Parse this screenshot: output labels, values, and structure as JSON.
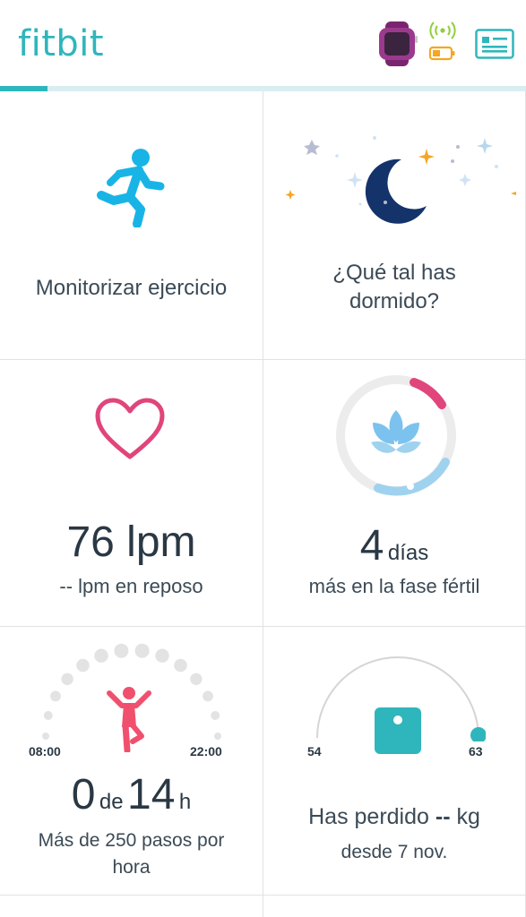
{
  "header": {
    "logo": "fitbit",
    "icons": {
      "device": "smartwatch-icon",
      "sync": "sync-signal-icon",
      "battery": "battery-low-icon",
      "profile": "profile-card-icon"
    },
    "progress_percent": 9,
    "colors": {
      "brand": "#2fb6bc",
      "watch": "#8b2a7a",
      "battery": "#f5a623",
      "signal": "#8ecf3c"
    }
  },
  "tiles": {
    "exercise": {
      "label": "Monitorizar ejercicio",
      "icon": "running-person-icon"
    },
    "sleep": {
      "label_line1": "¿Qué tal has",
      "label_line2": "dormido?",
      "icon": "moon-stars-icon"
    },
    "heart": {
      "value": "76 lpm",
      "sub": "-- lpm en reposo",
      "icon": "heart-icon"
    },
    "cycle": {
      "value": "4",
      "unit": "días",
      "sub": "más en la fase fértil",
      "icon": "lotus-icon"
    },
    "active": {
      "start": "08:00",
      "end": "22:00",
      "value": "0",
      "of": "de",
      "total": "14",
      "unit": "h",
      "sub_line1": "Más de 250 pasos por",
      "sub_line2": "hora",
      "icon": "stretching-person-icon",
      "hours_done": 0,
      "hours_total": 14
    },
    "weight": {
      "start": "54",
      "goal": "63",
      "label": "Has perdido",
      "value": "--",
      "unit": "kg",
      "sub": "desde 7 nov.",
      "icon": "scale-icon"
    }
  }
}
